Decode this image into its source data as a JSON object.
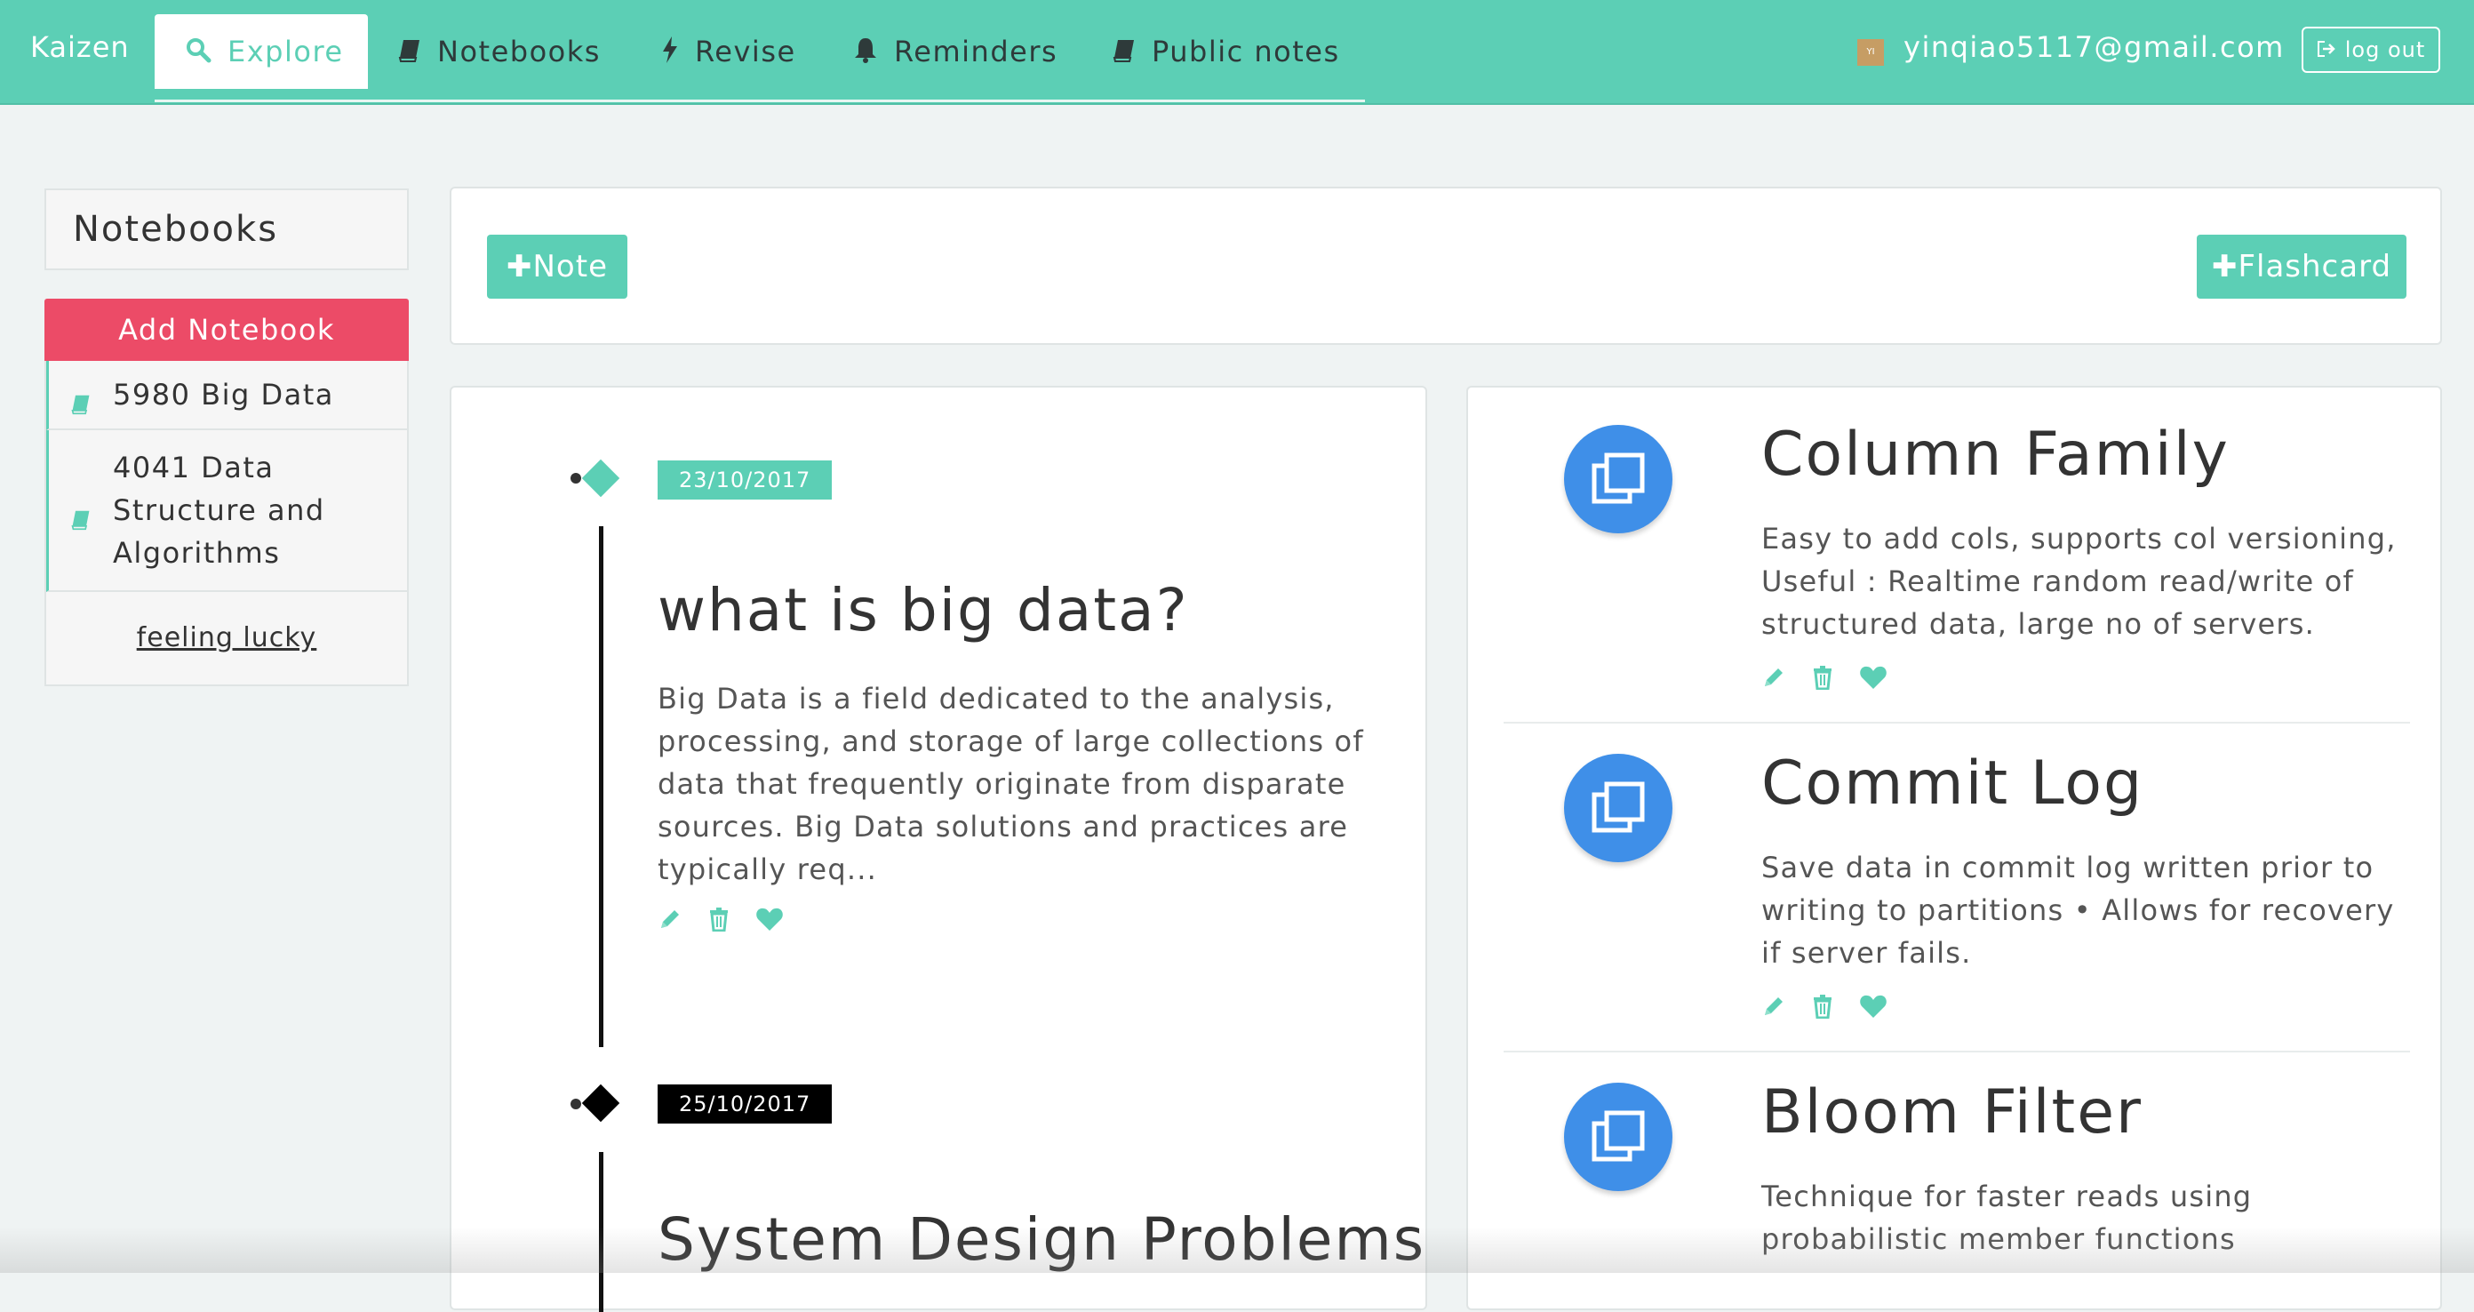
{
  "navbar": {
    "brand": "Kaizen",
    "items": [
      {
        "label": "Explore",
        "icon": "search-icon"
      },
      {
        "label": "Notebooks",
        "icon": "book-icon"
      },
      {
        "label": "Revise",
        "icon": "bolt-icon"
      },
      {
        "label": "Reminders",
        "icon": "bell-icon"
      },
      {
        "label": "Public notes",
        "icon": "book-icon"
      }
    ],
    "user_email": "yinqiao5117@gmail.com",
    "avatar_text": "YI",
    "logout_label": "log out"
  },
  "sidebar": {
    "title": "Notebooks",
    "add_label": "Add Notebook",
    "notebooks": [
      {
        "label": "5980 Big Data"
      },
      {
        "label": "4041 Data Structure and Algorithms"
      }
    ],
    "lucky_label": "feeling lucky"
  },
  "toolbar": {
    "note_label": "Note",
    "flashcard_label": "Flashcard"
  },
  "timeline": [
    {
      "date": "23/10/2017",
      "title": "what is big data?",
      "body": "Big Data is a field dedicated to the analysis, processing, and storage of large collections of data that frequently originate from disparate sources. Big Data solutions and practices are typically req..."
    },
    {
      "date": "25/10/2017",
      "title": "System Design Problems",
      "body": ""
    }
  ],
  "flashcards": [
    {
      "title": "Column Family",
      "body": "Easy to add cols, supports col versioning, Useful : Realtime random read/write of structured data, large no of servers."
    },
    {
      "title": "Commit Log",
      "body": "Save data in commit log written prior to writing to partitions • Allows for recovery if server fails."
    },
    {
      "title": "Bloom Filter",
      "body": "Technique for faster reads using probabilistic member functions"
    }
  ],
  "colors": {
    "accent": "#5ccfb5",
    "danger": "#ec4b67",
    "flashcard_icon": "#3f8fe8",
    "badge_dark": "#000000"
  }
}
